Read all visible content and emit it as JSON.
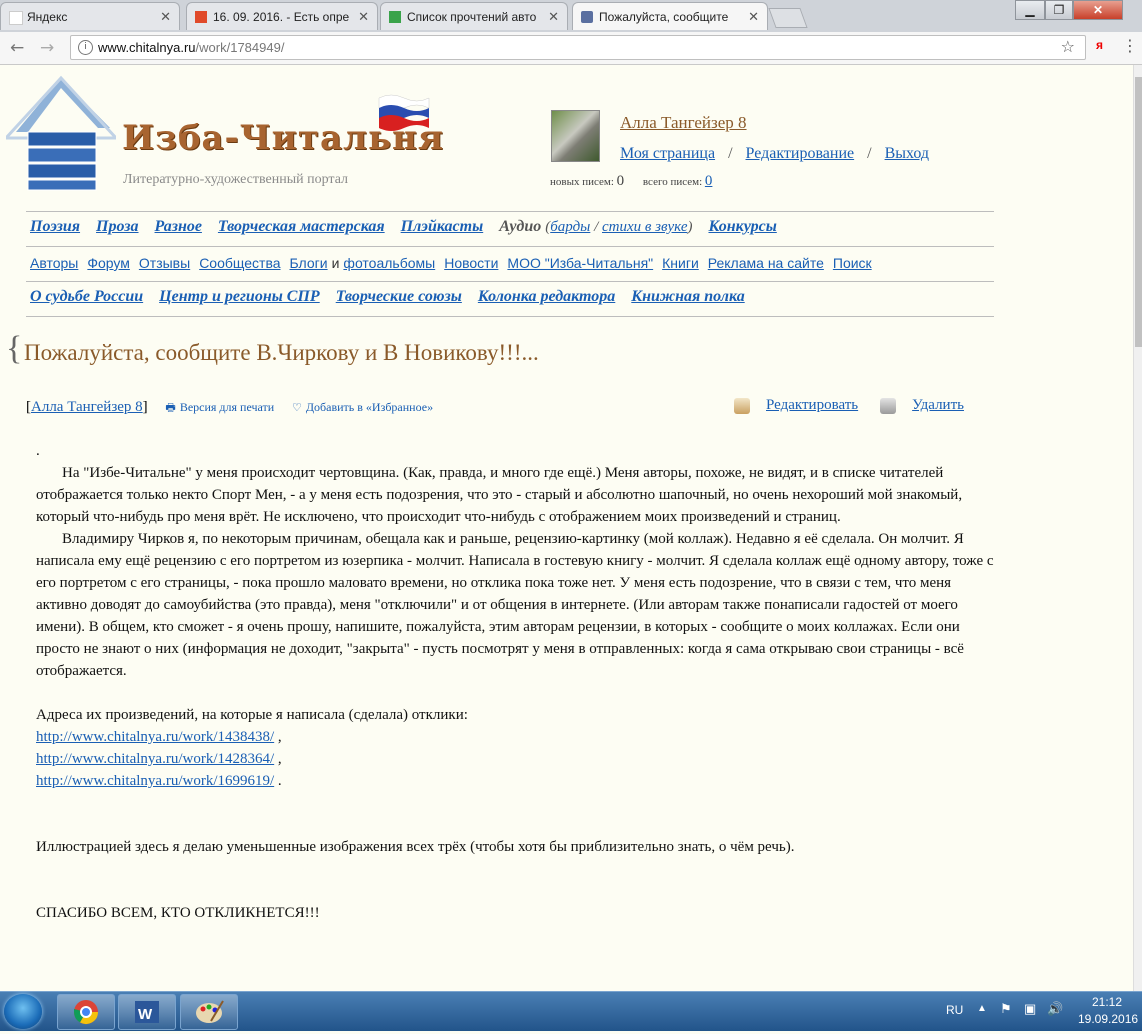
{
  "browser": {
    "tabs": [
      {
        "title": "Яндекс",
        "color": "#e8e8e8"
      },
      {
        "title": "16. 09. 2016. - Есть опре",
        "color": "#e04a2a"
      },
      {
        "title": "Список прочтений авто",
        "color": "#3aa34a"
      },
      {
        "title": "Пожалуйста, сообщите",
        "color": "#5a6fa0"
      }
    ],
    "url_host": "www.chitalnya.ru",
    "url_path": "/work/1784949/",
    "extension_label": "я"
  },
  "site": {
    "title": "Изба-Читальня",
    "subtitle": "Литературно-художественный портал"
  },
  "user": {
    "name": "Алла Тангейзер 8",
    "links": [
      "Моя страница",
      "Редактирование",
      "Выход"
    ],
    "new_mail_label": "новых писем:",
    "new_mail_count": "0",
    "total_mail_label": "всего писем:",
    "total_mail_count": "0"
  },
  "nav": {
    "main": [
      "Поэзия",
      "Проза",
      "Разное",
      "Творческая мастерская",
      "Плэйкасты"
    ],
    "audio_label": "Аудио",
    "audio_sub": [
      "барды",
      "стихи в звуке"
    ],
    "contests": "Конкурсы",
    "secondary": [
      "Авторы",
      "Форум",
      "Отзывы",
      "Сообщества",
      "Блоги"
    ],
    "secondary_and": "и",
    "secondary_rest": [
      "фотоальбомы",
      "Новости",
      "МОО \"Изба-Читальня\"",
      "Книги",
      "Реклама на сайте",
      "Поиск"
    ],
    "third": [
      "О судьбе России",
      "Центр и регионы СПР",
      "Творческие союзы",
      "Колонка редактора",
      "Книжная полка"
    ]
  },
  "work": {
    "title": "Пожалуйста, сообщите В.Чиркову и В Новикову!!!...",
    "author": "Алла Тангейзер 8",
    "print_label": "Версия для печати",
    "favorite_label": "Добавить в «Избранное»",
    "edit_label": "Редактировать",
    "delete_label": "Удалить",
    "dot": ".",
    "para1": "На \"Избе-Читальне\" у меня происходит чертовщина. (Как, правда, и много где ещё.) Меня авторы, похоже, не видят, и в списке читателей отображается только некто Спорт Мен, - а у меня есть подозрения, что это - старый и абсолютно шапочный, но очень нехороший мой знакомый,  который что-нибудь про меня врёт. Не исключено, что происходит что-нибудь с отображением моих произведений и страниц.",
    "para2": "Владимиру Чирков я, по некоторым причинам, обещала как и раньше, рецензию-картинку (мой коллаж). Недавно я её сделала. Он молчит. Я написала ему ещё рецензию с его портретом из юзерпика - молчит. Написала в гостевую книгу - молчит. Я сделала коллаж ещё одному автору, тоже с его портретом с его страницы, - пока прошло маловато времени, но отклика пока тоже нет. У меня есть подозрение, что в связи с тем, что меня активно доводят до самоубийства (это правда), меня \"отключили\" и от общения в интернете. (Или авторам также понаписали гадостей от моего имени). В общем, кто сможет - я очень прошу, напишите, пожалуйста, этим авторам рецензии, в которых - сообщите о моих коллажах. Если они просто не знают о них (информация не доходит, \"закрыта\" - пусть посмотрят у меня в отправленных: когда я сама открываю свои страницы - всё отображается.",
    "addresses_label": "Адреса их произведений, на которые я написала (сделала) отклики:",
    "links": [
      {
        "url": "http://www.chitalnya.ru/work/1438438/",
        "suffix": " ,"
      },
      {
        "url": "http://www.chitalnya.ru/work/1428364/",
        "suffix": " ,"
      },
      {
        "url": "http://www.chitalnya.ru/work/1699619/",
        "suffix": " ."
      }
    ],
    "illustration_note": "Иллюстрацией здесь я делаю уменьшенные изображения всех трёх (чтобы хотя бы приблизительно знать, о чём речь).",
    "thanks": "СПАСИБО ВСЕМ, КТО ОТКЛИКНЕТСЯ!!!"
  },
  "taskbar": {
    "lang": "RU",
    "time": "21:12",
    "date": "19.09.2016"
  }
}
